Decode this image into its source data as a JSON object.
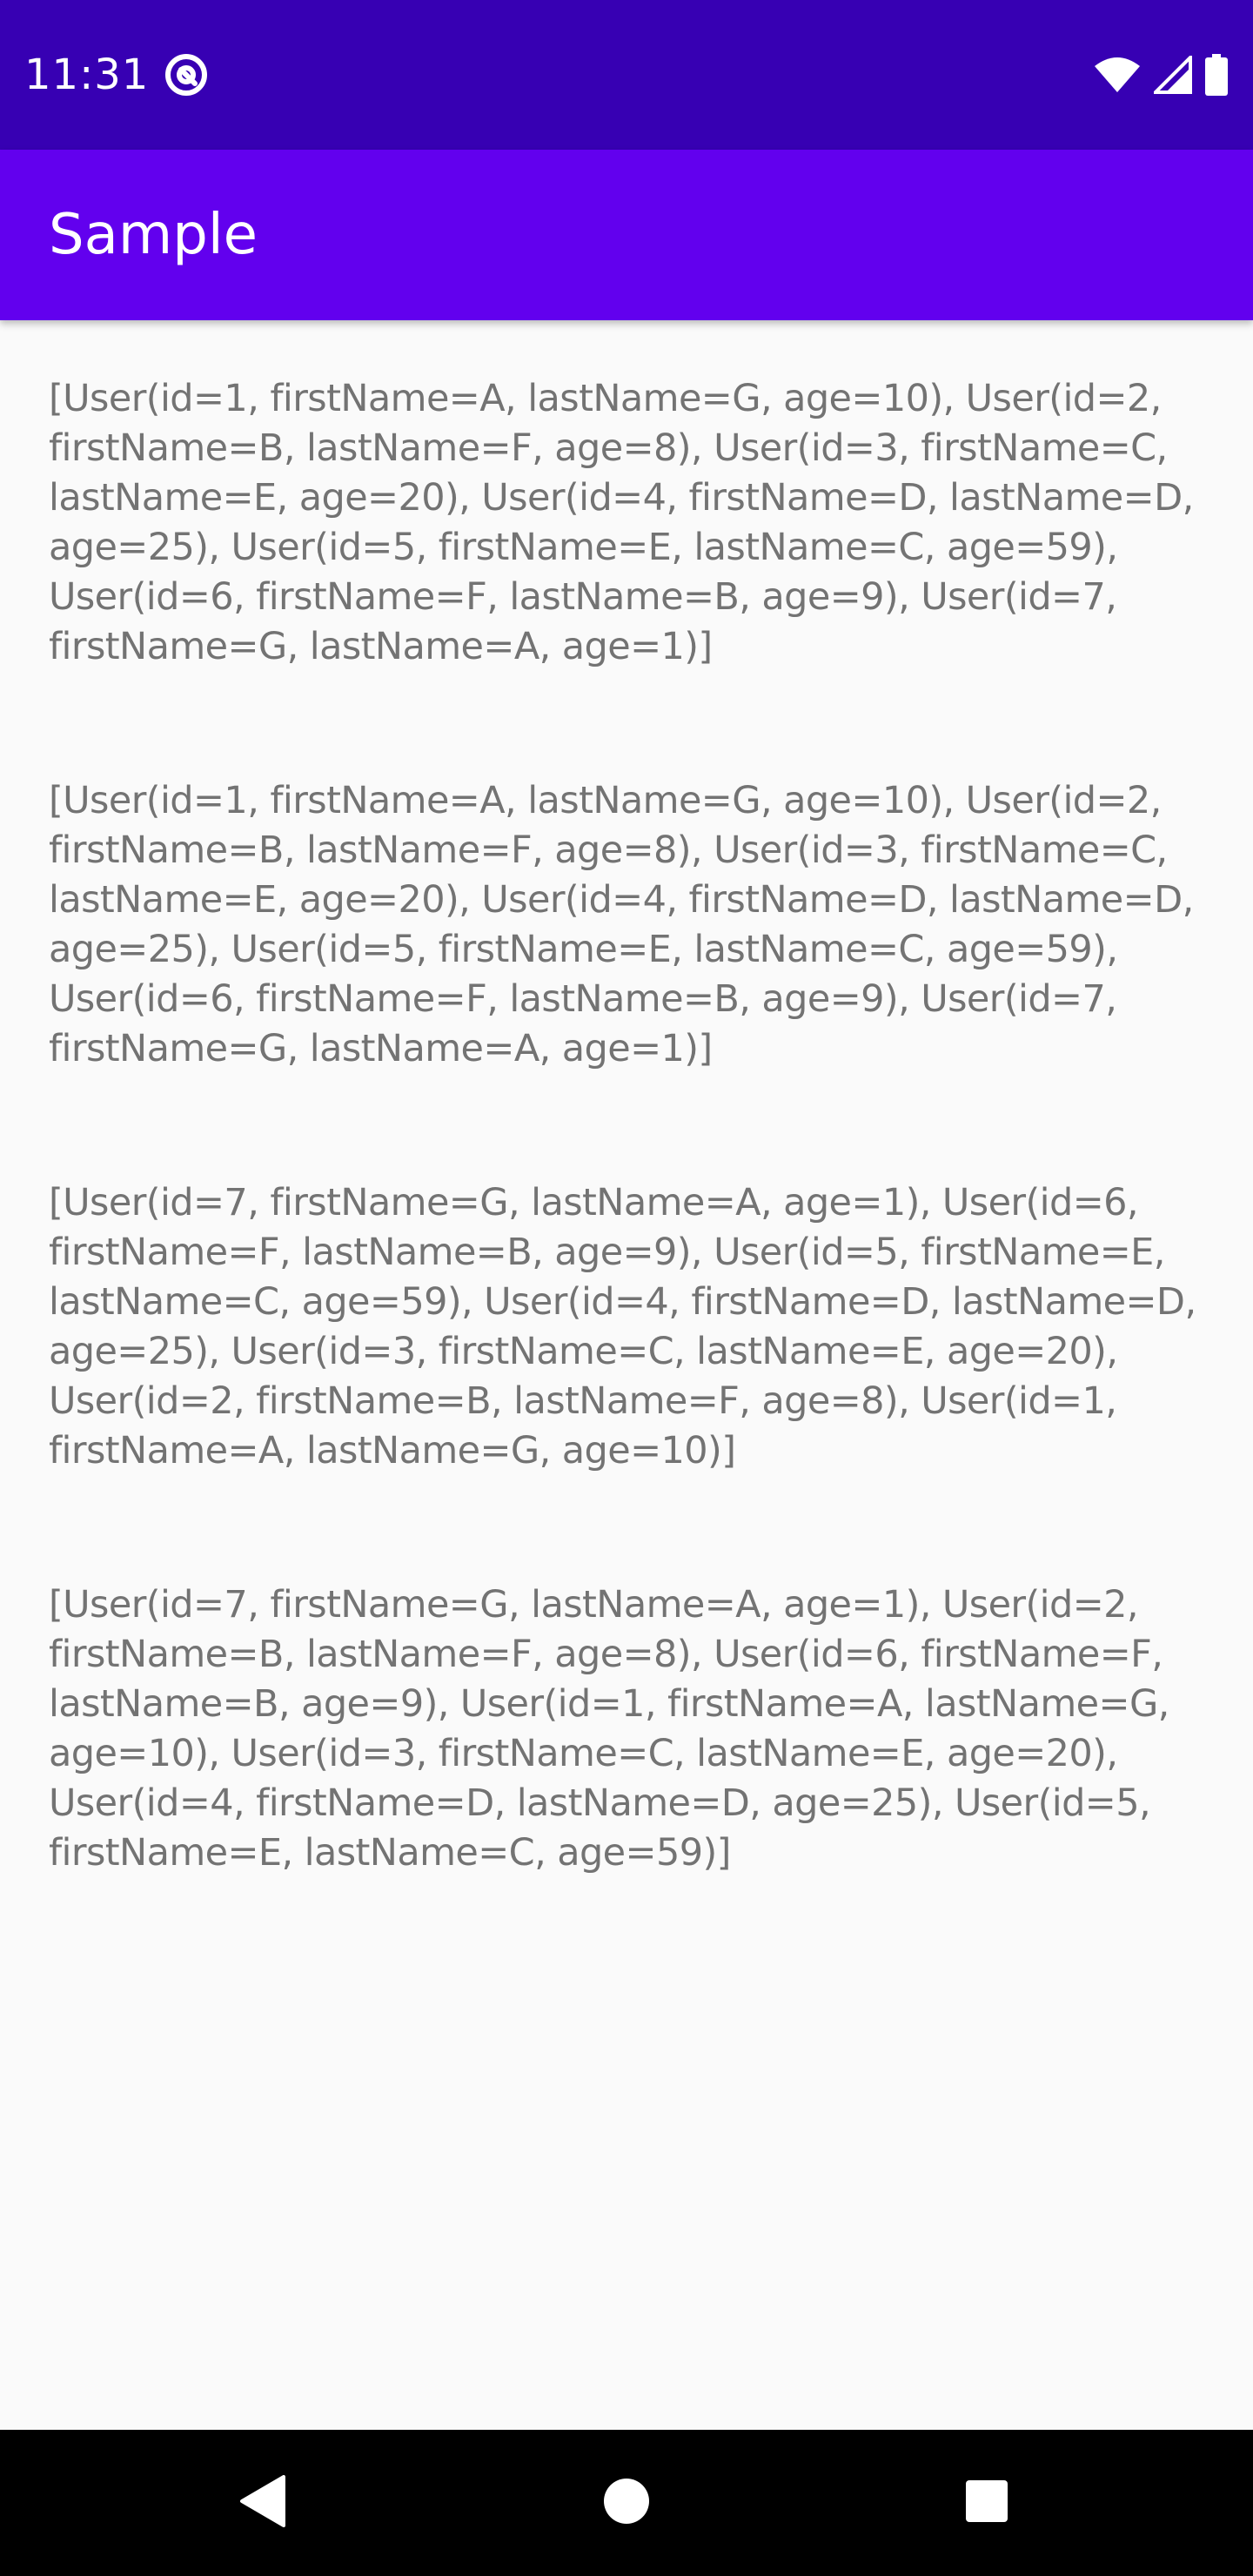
{
  "status_bar": {
    "time": "11:31",
    "notification_icon": "at-sign-icon",
    "icons": [
      "wifi-icon",
      "cell-signal-icon",
      "battery-icon"
    ]
  },
  "app_bar": {
    "title": "Sample"
  },
  "content": {
    "lists": [
      "[User(id=1, firstName=A, lastName=G, age=10), User(id=2, firstName=B, lastName=F, age=8), User(id=3, firstName=C, lastName=E, age=20), User(id=4, firstName=D, lastName=D, age=25), User(id=5, firstName=E, lastName=C, age=59), User(id=6, firstName=F, lastName=B, age=9), User(id=7, firstName=G, lastName=A, age=1)]",
      "[User(id=1, firstName=A, lastName=G, age=10), User(id=2, firstName=B, lastName=F, age=8), User(id=3, firstName=C, lastName=E, age=20), User(id=4, firstName=D, lastName=D, age=25), User(id=5, firstName=E, lastName=C, age=59), User(id=6, firstName=F, lastName=B, age=9), User(id=7, firstName=G, lastName=A, age=1)]",
      "[User(id=7, firstName=G, lastName=A, age=1), User(id=6, firstName=F, lastName=B, age=9), User(id=5, firstName=E, lastName=C, age=59), User(id=4, firstName=D, lastName=D, age=25), User(id=3, firstName=C, lastName=E, age=20), User(id=2, firstName=B, lastName=F, age=8), User(id=1, firstName=A, lastName=G, age=10)]",
      "[User(id=7, firstName=G, lastName=A, age=1), User(id=2, firstName=B, lastName=F, age=8), User(id=6, firstName=F, lastName=B, age=9), User(id=1, firstName=A, lastName=G, age=10), User(id=3, firstName=C, lastName=E, age=20), User(id=4, firstName=D, lastName=D, age=25), User(id=5, firstName=E, lastName=C, age=59)]"
    ]
  },
  "nav_bar": {
    "buttons": [
      "back-icon",
      "home-icon",
      "recents-icon"
    ]
  },
  "colors": {
    "status_bar": "#3700b3",
    "app_bar": "#6200ee",
    "background": "#fafafa",
    "text": "#737373",
    "nav_bar": "#000000"
  }
}
